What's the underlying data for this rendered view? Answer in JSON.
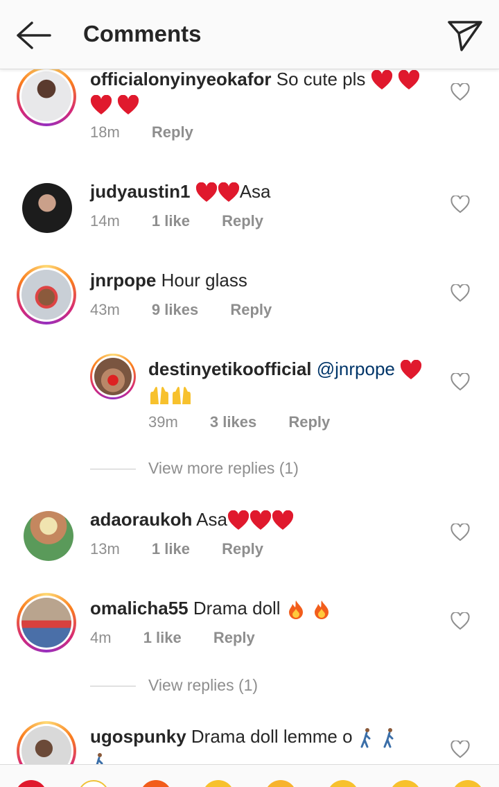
{
  "header": {
    "title": "Comments"
  },
  "comments": [
    {
      "username": "officialonyinyeokafor",
      "text_before": "So cute pls",
      "time": "18m",
      "likes": "",
      "reply": "Reply"
    },
    {
      "username": "judyaustin1",
      "text_after": "Asa",
      "time": "14m",
      "likes": "1 like",
      "reply": "Reply"
    },
    {
      "username": "jnrpope",
      "text": "Hour glass",
      "time": "43m",
      "likes": "9 likes",
      "reply": "Reply"
    },
    {
      "username": "destinyetikoofficial",
      "mention": "@jnrpope",
      "time": "39m",
      "likes": "3 likes",
      "reply": "Reply"
    },
    {
      "username": "adaoraukoh",
      "text": "Asa",
      "time": "13m",
      "likes": "1 like",
      "reply": "Reply"
    },
    {
      "username": "omalicha55",
      "text": "Drama doll",
      "time": "4m",
      "likes": "1 like",
      "reply": "Reply"
    },
    {
      "username": "ugospunky",
      "text": "Drama doll lemme o"
    }
  ],
  "view_more_replies": "View more replies (1)",
  "view_replies": "View replies (1)",
  "colors": {
    "text": "#262626",
    "meta": "#8e8e8e",
    "mention": "#003569",
    "heart": "#e0192d"
  },
  "icons": [
    "back-arrow-icon",
    "send-icon",
    "heart-outline-icon",
    "red-heart-emoji",
    "raised-hands-emoji",
    "fire-emoji",
    "walking-man-emoji"
  ]
}
